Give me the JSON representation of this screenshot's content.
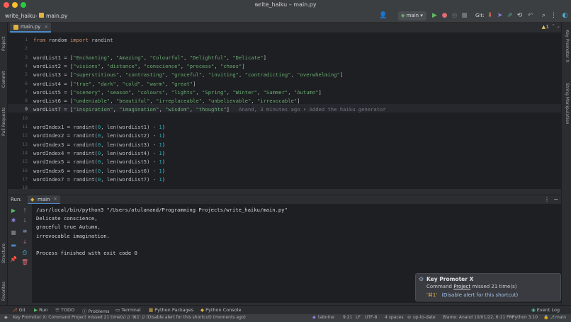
{
  "window": {
    "title": "write_haiku – main.py"
  },
  "colors": {
    "close": "#ff5f57",
    "minimize": "#febc2e",
    "maximize": "#28c840",
    "accent": "#4a88c7"
  },
  "breadcrumb": {
    "project": "write_haiku",
    "file": "main.py"
  },
  "toolbar": {
    "branch": "main",
    "git_label": "Git:"
  },
  "tabs": [
    {
      "label": "main.py"
    }
  ],
  "left_tools": {
    "project": "Project",
    "commit": "Commit",
    "pull_requests": "Pull Requests",
    "structure": "Structure",
    "favorites": "Favorites"
  },
  "right_tools": {
    "key_promoter": "Key Promoter X",
    "string_manipulation": "String Manipulation"
  },
  "editor": {
    "warnings": "1",
    "lines": [
      {
        "n": "1",
        "code": "from random import randint"
      },
      {
        "n": "2",
        "code": ""
      },
      {
        "n": "3",
        "code": "wordList1 = [\"Enchanting\", \"Amazing\", \"Colourful\", \"Delightful\", \"Delicate\"]"
      },
      {
        "n": "4",
        "code": "wordList2 = [\"visions\", \"distance\", \"conscience\", \"process\", \"chaos\"]"
      },
      {
        "n": "5",
        "code": "wordList3 = [\"superstitious\", \"contrasting\", \"graceful\", \"inviting\", \"contradicting\", \"overwhelming\"]"
      },
      {
        "n": "6",
        "code": "wordList4 = [\"true\", \"dark\", \"cold\", \"warm\", \"great\"]"
      },
      {
        "n": "7",
        "code": "wordList5 = [\"scenery\", \"season\", \"colours\", \"lights\", \"Spring\", \"Winter\", \"Summer\", \"Autumn\"]"
      },
      {
        "n": "8",
        "code": "wordList6 = [\"undeniable\", \"beautiful\", \"irreplaceable\", \"unbelievable\", \"irrevocable\"]"
      },
      {
        "n": "9",
        "code": "wordList7 = [\"inspiration\", \"imagination\", \"wisdom\", \"thoughts\"]"
      },
      {
        "n": "10",
        "code": ""
      },
      {
        "n": "11",
        "code": "wordIndex1 = randint(0, len(wordList1) - 1)"
      },
      {
        "n": "12",
        "code": "wordIndex2 = randint(0, len(wordList2) - 1)"
      },
      {
        "n": "13",
        "code": "wordIndex3 = randint(0, len(wordList3) - 1)"
      },
      {
        "n": "14",
        "code": "wordIndex4 = randint(0, len(wordList4) - 1)"
      },
      {
        "n": "15",
        "code": "wordIndex5 = randint(0, len(wordList5) - 1)"
      },
      {
        "n": "16",
        "code": "wordIndex6 = randint(0, len(wordList6) - 1)"
      },
      {
        "n": "17",
        "code": "wordIndex7 = randint(0, len(wordList7) - 1)"
      },
      {
        "n": "18",
        "code": ""
      }
    ],
    "blame": "Anand, 3 minutes ago • Added the haiku generator"
  },
  "run": {
    "label": "Run:",
    "tab": "main",
    "output": [
      "/usr/local/bin/python3 \"/Users/atulanand/Programming Projects/write_haiku/main.py\"",
      "Delicate conscience,",
      "graceful true Autumn,",
      "irrevocable imagination.",
      "",
      "Process finished with exit code 0"
    ]
  },
  "popup": {
    "title": "Key Promoter X",
    "body_prefix": "Command ",
    "body_link": "Project",
    "body_suffix": " missed 21 time(s)",
    "shortcut": "'⌘1'",
    "disable": "(Disable alert for this shortcut)"
  },
  "tooltabs": [
    "Git",
    "Run",
    "TODO",
    "Problems",
    "Terminal",
    "Python Packages",
    "Python Console",
    "Event Log"
  ],
  "statusbar": {
    "message": "Key Promoter X: Command Project missed 21 time(s) // '⌘1' // (Disable alert for this shortcut) (moments ago)",
    "plugin": "tabnine",
    "position": "9:21",
    "line_sep": "LF",
    "encoding": "UTF-8",
    "indent": "4 spaces",
    "vcs": "up-to-date",
    "blame": "Blame: Anand 10/01/22, 6:11 PM",
    "interpreter": "Python 3.10",
    "branch": "main"
  }
}
